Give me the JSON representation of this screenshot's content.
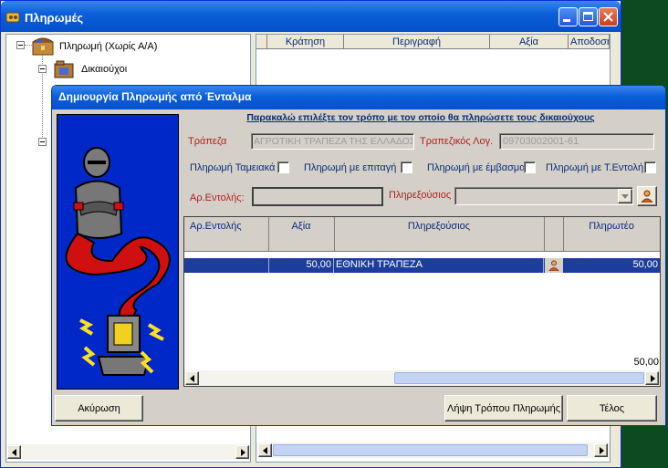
{
  "main_window": {
    "title": "Πληρωμές",
    "tree": {
      "root_label": "Πληρωμή (Χωρίς Α/Α)",
      "child_label": "Δικαιούχοι"
    },
    "list_columns": [
      "Κράτηση",
      "Περιγραφή",
      "Αξία",
      "Αποδοση"
    ]
  },
  "dialog": {
    "title": "Δημιουργία Πληρωμής από Ένταλμα",
    "instruction": "Παρακαλώ επιλέξτε τον τρόπο με τον οποίο θα πληρώσετε τους δικαιούχους",
    "bank_label": "Τράπεζα",
    "bank_value": "ΑΓΡΟΤΙΚΗ ΤΡΑΠΕΖΑ ΤΗΣ ΕΛΛΑΔΟΣ",
    "account_label": "Τραπεζικός Λογ.",
    "account_value": "09703002001-61",
    "pay_cash_label": "Πληρωμή Ταμειακά",
    "pay_check_label": "Πληρωμή με επιταγή",
    "pay_transfer_label": "Πληρωμή με έμβασμα",
    "pay_order_label": "Πληρωμή με Τ.Εντολή",
    "order_no_label": "Αρ.Εντολής:",
    "order_no_value": "",
    "payee_label": "Πληρεξούσιος",
    "payee_value": "",
    "grid": {
      "columns": [
        "Αρ.Εντολής",
        "Αξία",
        "Πληρεξούσιος",
        "",
        "Πληρωτέο"
      ],
      "rows": [
        {
          "order_no": "",
          "value": "50,00",
          "payee": "ΕΘΝΙΚΗ ΤΡΑΠΕΖΑ",
          "payable": "50,00"
        }
      ],
      "total": "50,00"
    },
    "cancel_label": "Ακύρωση",
    "get_method_label": "Λήψη Τρόπου Πληρωμής",
    "finish_label": "Τέλος"
  },
  "colors": {
    "title_blue": "#0a5fd8",
    "selection": "#1c3d9c",
    "genie_background": "#0028c8",
    "label_red": "#b02020"
  }
}
